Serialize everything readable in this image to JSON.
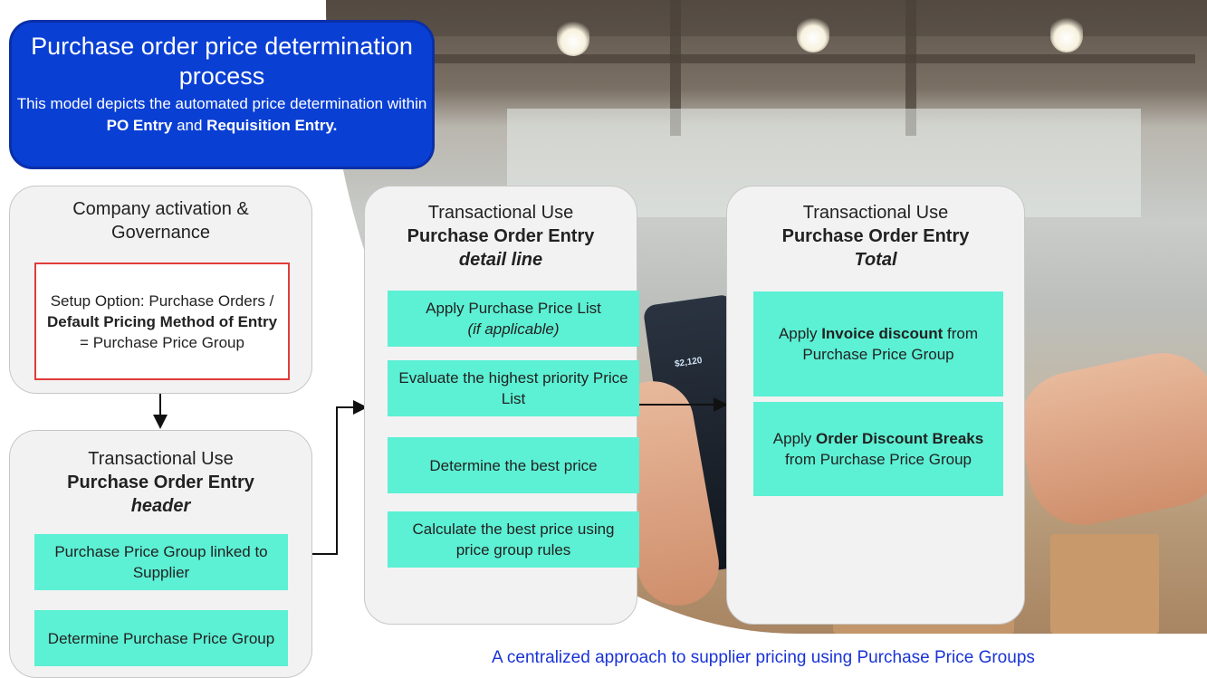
{
  "title": {
    "heading": "Purchase order price determination process",
    "desc_pre": "This model depicts the automated price determination within ",
    "desc_bold1": "PO Entry",
    "desc_mid": " and ",
    "desc_bold2": "Requisition Entry."
  },
  "governance": {
    "heading": "Company activation & Governance",
    "setup_pre": "Setup Option: Purchase Orders / ",
    "setup_bold": "Default Pricing Method of Entry",
    "setup_post": " = Purchase Price Group"
  },
  "header_card": {
    "line1": "Transactional Use",
    "line2": "Purchase Order Entry",
    "line3": "header",
    "step1": "Purchase Price Group linked to Supplier",
    "step2": "Determine Purchase Price Group"
  },
  "detail_card": {
    "line1": "Transactional Use",
    "line2": "Purchase Order Entry",
    "line3": "detail line",
    "step1": "Apply Purchase Price List",
    "step1_note": "(if applicable)",
    "step2": "Evaluate the highest priority Price List",
    "step3": "Determine the best price",
    "step4": "Calculate the best price using price group rules"
  },
  "total_card": {
    "line1": "Transactional Use",
    "line2": "Purchase Order Entry",
    "line3": "Total",
    "step1_pre": "Apply ",
    "step1_bold": "Invoice discount",
    "step1_post": " from Purchase Price Group",
    "step2_pre": "Apply ",
    "step2_bold": "Order Discount Breaks",
    "step2_post": " from Purchase Price Group"
  },
  "photo_text": "$2,120",
  "footer": "A centralized approach to supplier pricing using Purchase Price Groups",
  "colors": {
    "title_bg": "#0a3fd4",
    "step_bg": "#5cf0d4",
    "card_bg": "#f2f2f2",
    "setup_border": "#e23b3b",
    "footer_text": "#1a33d6"
  }
}
